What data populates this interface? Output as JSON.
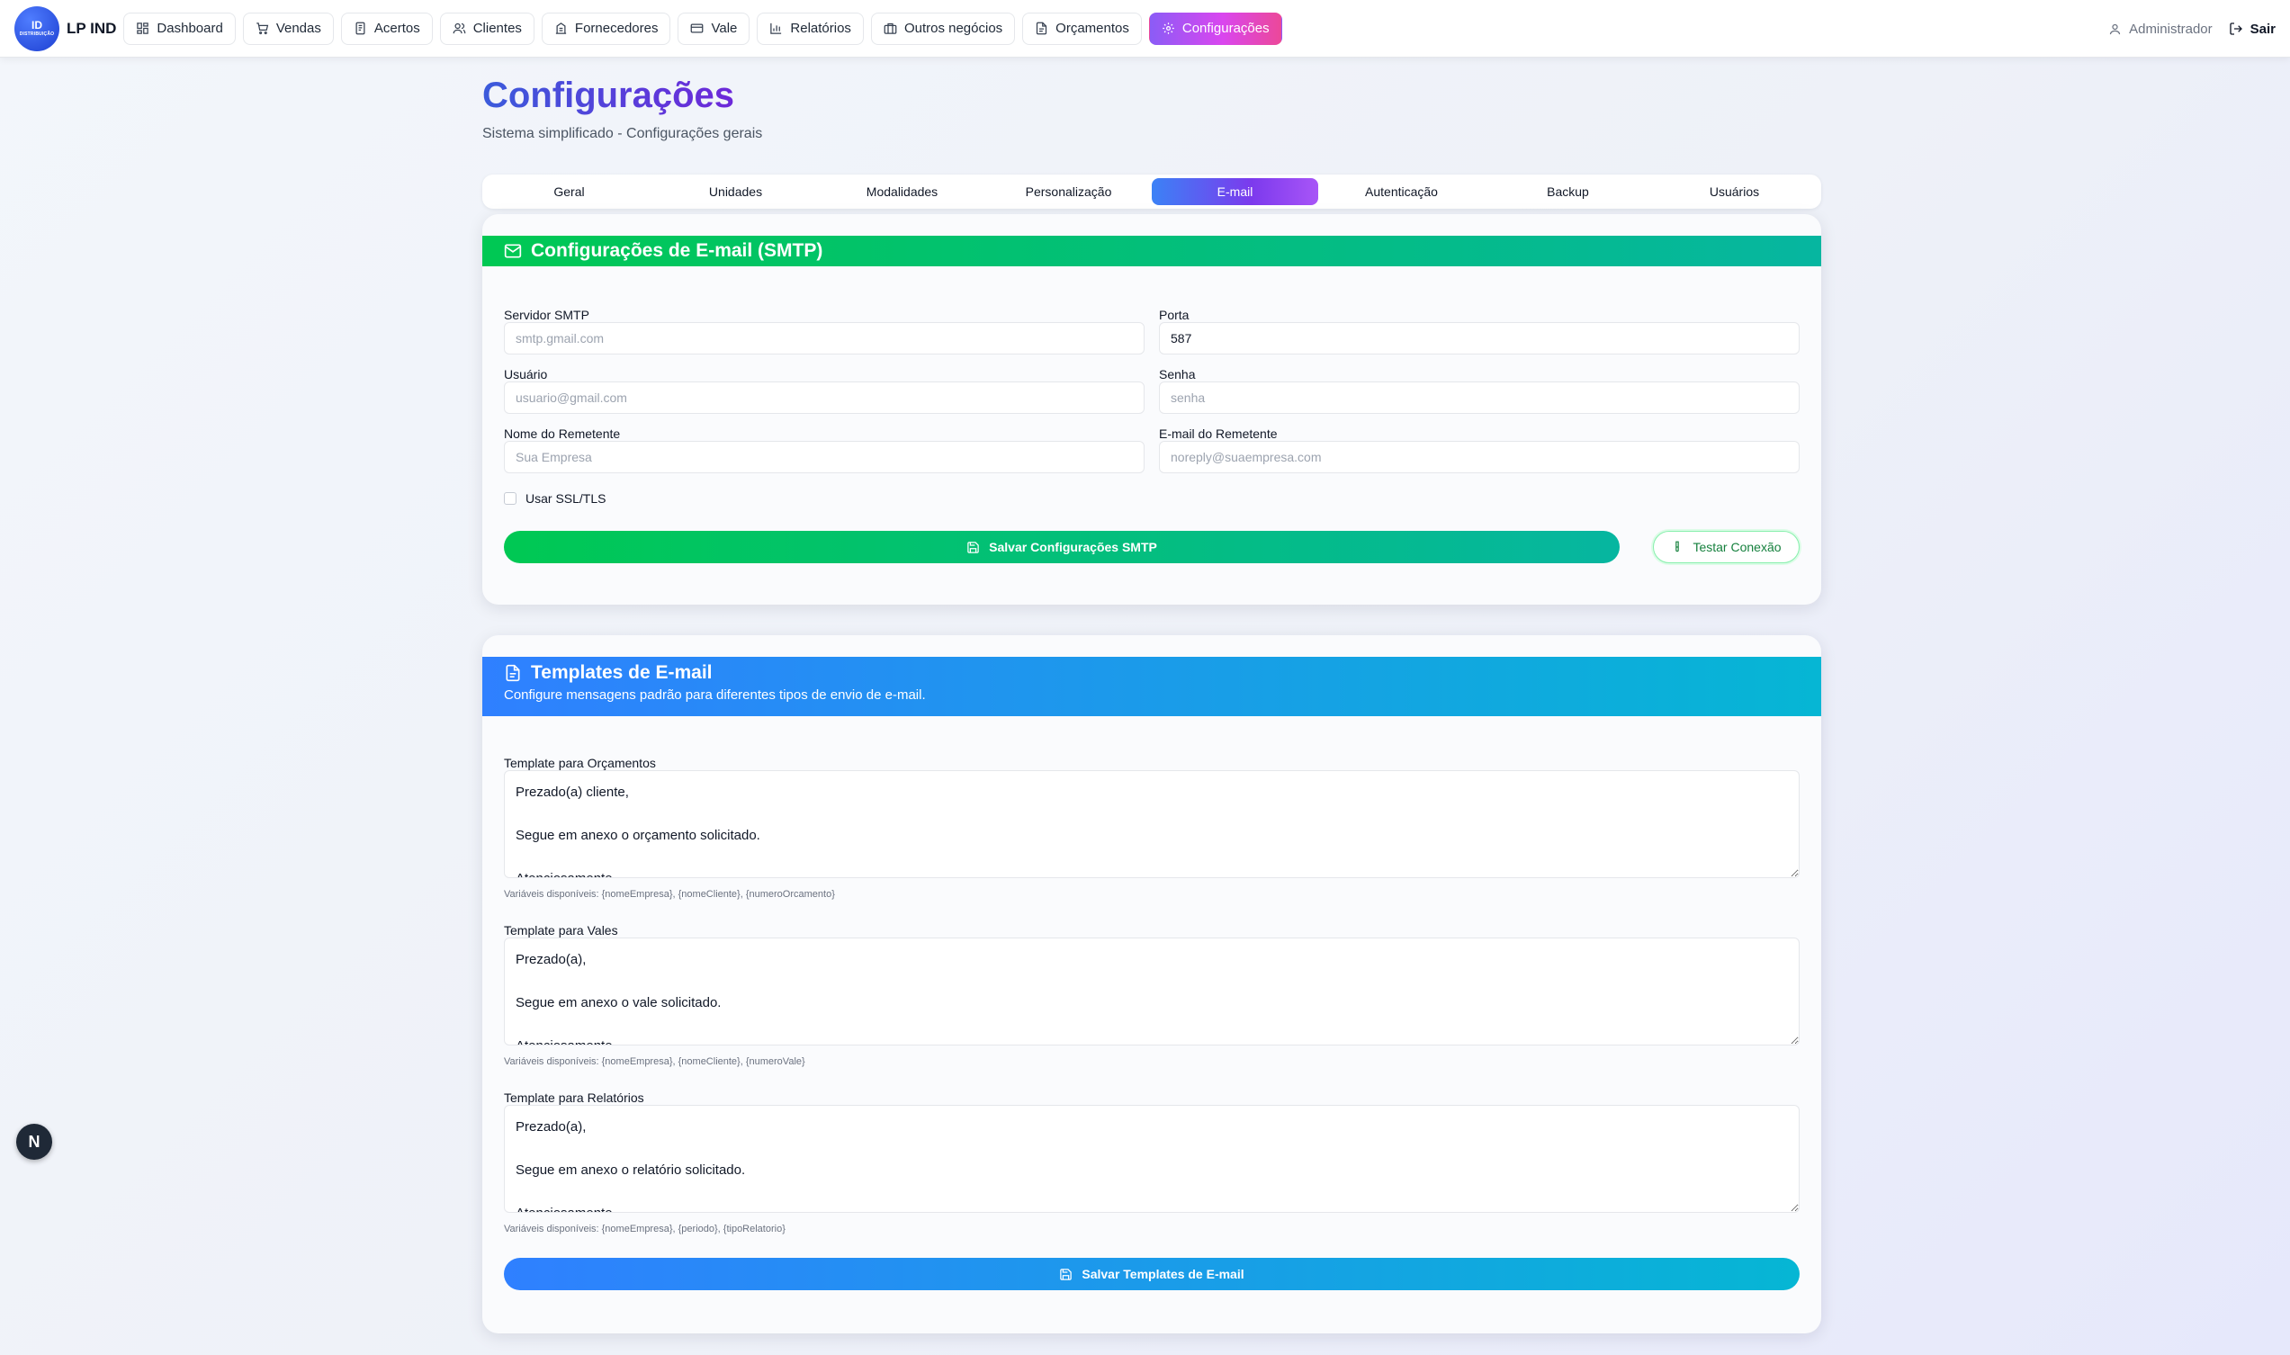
{
  "app": {
    "logo_line1": "ID",
    "logo_line2": "DISTRIBUIÇÃO",
    "brand": "LP IND"
  },
  "nav": {
    "items": [
      {
        "label": "Dashboard",
        "icon": "grid-icon"
      },
      {
        "label": "Vendas",
        "icon": "cart-icon"
      },
      {
        "label": "Acertos",
        "icon": "document-icon"
      },
      {
        "label": "Clientes",
        "icon": "users-icon"
      },
      {
        "label": "Fornecedores",
        "icon": "building-icon"
      },
      {
        "label": "Vale",
        "icon": "card-icon"
      },
      {
        "label": "Relatórios",
        "icon": "bar-chart-icon"
      },
      {
        "label": "Outros negócios",
        "icon": "briefcase-icon"
      },
      {
        "label": "Orçamentos",
        "icon": "file-text-icon"
      },
      {
        "label": "Configurações",
        "icon": "gear-icon",
        "active": true
      }
    ],
    "user": "Administrador",
    "logout": "Sair"
  },
  "page": {
    "title": "Configurações",
    "subtitle": "Sistema simplificado - Configurações gerais"
  },
  "tabs": [
    "Geral",
    "Unidades",
    "Modalidades",
    "Personalização",
    "E-mail",
    "Autenticação",
    "Backup",
    "Usuários"
  ],
  "active_tab": "E-mail",
  "smtp": {
    "title": "Configurações de E-mail (SMTP)",
    "server_label": "Servidor SMTP",
    "server_placeholder": "smtp.gmail.com",
    "port_label": "Porta",
    "port_value": "587",
    "user_label": "Usuário",
    "user_placeholder": "usuario@gmail.com",
    "password_label": "Senha",
    "password_placeholder": "senha",
    "sender_name_label": "Nome do Remetente",
    "sender_name_placeholder": "Sua Empresa",
    "sender_email_label": "E-mail do Remetente",
    "sender_email_placeholder": "noreply@suaempresa.com",
    "ssl_label": "Usar SSL/TLS",
    "save_button": "Salvar Configurações SMTP",
    "test_button": "Testar Conexão"
  },
  "templates": {
    "title": "Templates de E-mail",
    "description": "Configure mensagens padrão para diferentes tipos de envio de e-mail.",
    "quote_label": "Template para Orçamentos",
    "quote_value": "Prezado(a) cliente,\n\nSegue em anexo o orçamento solicitado.\n\nAtenciosamente",
    "quote_hint": "Variáveis disponíveis: {nomeEmpresa}, {nomeCliente}, {numeroOrcamento}",
    "voucher_label": "Template para Vales",
    "voucher_value": "Prezado(a),\n\nSegue em anexo o vale solicitado.\n\nAtenciosamente",
    "voucher_hint": "Variáveis disponíveis: {nomeEmpresa}, {nomeCliente}, {numeroVale}",
    "report_label": "Template para Relatórios",
    "report_value": "Prezado(a),\n\nSegue em anexo o relatório solicitado.\n\nAtenciosamente",
    "report_hint": "Variáveis disponíveis: {nomeEmpresa}, {periodo}, {tipoRelatorio}",
    "save_button": "Salvar Templates de E-mail"
  },
  "badge": "N"
}
